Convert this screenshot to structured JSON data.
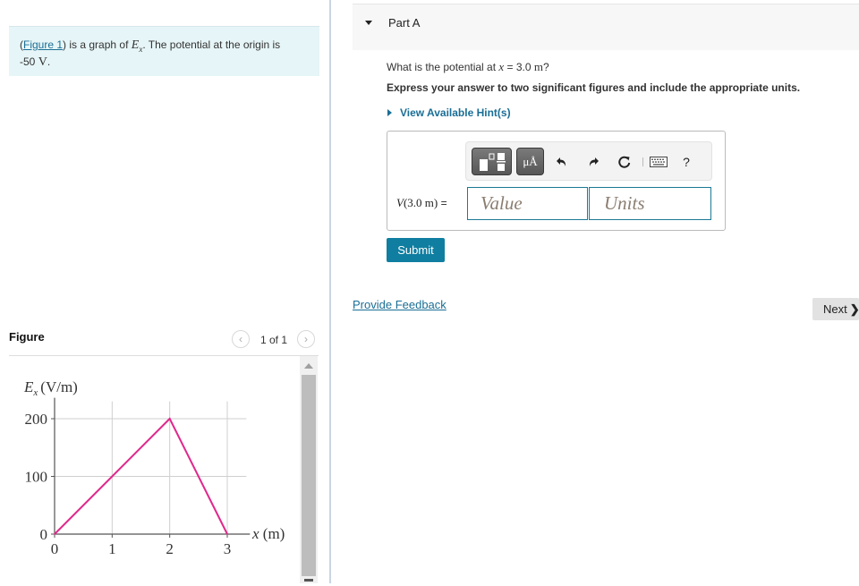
{
  "intro": {
    "figure_link": "Figure 1",
    "text_before_math": ") is a graph of ",
    "open_paren": "(",
    "math_symbol": "E",
    "math_subscript": "x",
    "text_after_math": ". The potential at the origin is",
    "value": "-50",
    "unit": "V",
    "end": "."
  },
  "figure": {
    "title": "Figure",
    "pager": "1 of 1",
    "prev_icon": "chevron-left-icon",
    "next_icon": "chevron-right-icon"
  },
  "chart_data": {
    "type": "line",
    "title": "",
    "xlabel": "x (m)",
    "ylabel": "E_x (V/m)",
    "ylabel_main": "E",
    "ylabel_sub": "x",
    "ylabel_unit": "(V/m)",
    "xlim": [
      0,
      3.3
    ],
    "ylim": [
      0,
      230
    ],
    "xticks": [
      0,
      1,
      2,
      3
    ],
    "yticks": [
      0,
      100,
      200
    ],
    "grid": true,
    "series": [
      {
        "name": "E_x",
        "color": "#e0288c",
        "x": [
          0,
          1,
          2,
          3
        ],
        "y": [
          0,
          100,
          200,
          0
        ]
      }
    ]
  },
  "part": {
    "title": "Part A",
    "question_prefix": "What is the potential at ",
    "question_var": "x",
    "question_eq": " = 3.0 ",
    "question_unit": "m",
    "question_suffix": "?",
    "instruction": "Express your answer to two significant figures and include the appropriate units.",
    "hint_label": "View Available Hint(s)"
  },
  "toolbar": {
    "units_label": "μÅ",
    "help_label": "?"
  },
  "answer": {
    "label_var": "V",
    "label_arg": "(3.0 m)",
    "label_eq": " =",
    "value_placeholder": "Value",
    "units_placeholder": "Units",
    "submit_label": "Submit"
  },
  "footer": {
    "feedback_label": "Provide Feedback",
    "next_label": "Next",
    "next_chevron": "❯"
  },
  "colors": {
    "accent": "#0f7ea0",
    "link": "#1a6e95",
    "line": "#e0288c",
    "intro_bg": "#e6f5f7"
  }
}
